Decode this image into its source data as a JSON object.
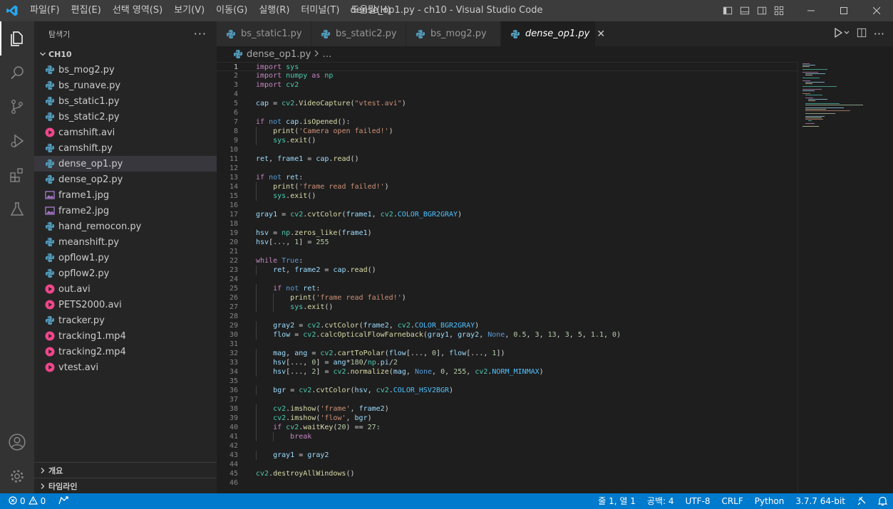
{
  "window": {
    "title": "dense_op1.py - ch10 - Visual Studio Code"
  },
  "menu": [
    "파일(F)",
    "편집(E)",
    "선택 영역(S)",
    "보기(V)",
    "이동(G)",
    "실행(R)",
    "터미널(T)",
    "도움말(H)"
  ],
  "sidebar": {
    "title": "탐색기",
    "folder": "CH10",
    "files": [
      {
        "name": "bs_mog2.py",
        "type": "py"
      },
      {
        "name": "bs_runave.py",
        "type": "py"
      },
      {
        "name": "bs_static1.py",
        "type": "py"
      },
      {
        "name": "bs_static2.py",
        "type": "py"
      },
      {
        "name": "camshift.avi",
        "type": "video"
      },
      {
        "name": "camshift.py",
        "type": "py"
      },
      {
        "name": "dense_op1.py",
        "type": "py",
        "selected": true
      },
      {
        "name": "dense_op2.py",
        "type": "py"
      },
      {
        "name": "frame1.jpg",
        "type": "image"
      },
      {
        "name": "frame2.jpg",
        "type": "image"
      },
      {
        "name": "hand_remocon.py",
        "type": "py"
      },
      {
        "name": "meanshift.py",
        "type": "py"
      },
      {
        "name": "opflow1.py",
        "type": "py"
      },
      {
        "name": "opflow2.py",
        "type": "py"
      },
      {
        "name": "out.avi",
        "type": "video"
      },
      {
        "name": "PETS2000.avi",
        "type": "video"
      },
      {
        "name": "tracker.py",
        "type": "py"
      },
      {
        "name": "tracking1.mp4",
        "type": "video"
      },
      {
        "name": "tracking2.mp4",
        "type": "video"
      },
      {
        "name": "vtest.avi",
        "type": "video"
      }
    ],
    "outline_label": "개요",
    "timeline_label": "타임라인"
  },
  "tabs": [
    {
      "label": "bs_static1.py",
      "active": false
    },
    {
      "label": "bs_static2.py",
      "active": false
    },
    {
      "label": "bs_mog2.py",
      "active": false
    },
    {
      "label": "dense_op1.py",
      "active": true
    }
  ],
  "breadcrumb": {
    "file": "dense_op1.py",
    "rest": "…"
  },
  "code": {
    "current_line": 1,
    "lines": [
      "import sys",
      "import numpy as np",
      "import cv2",
      "",
      "cap = cv2.VideoCapture(\"vtest.avi\")",
      "",
      "if not cap.isOpened():",
      "    print('Camera open failed!')",
      "    sys.exit()",
      "",
      "ret, frame1 = cap.read()",
      "",
      "if not ret:",
      "    print('frame read failed!')",
      "    sys.exit()",
      "",
      "gray1 = cv2.cvtColor(frame1, cv2.COLOR_BGR2GRAY)",
      "",
      "hsv = np.zeros_like(frame1)",
      "hsv[..., 1] = 255",
      "",
      "while True:",
      "    ret, frame2 = cap.read()",
      "",
      "    if not ret:",
      "        print('frame read failed!')",
      "        sys.exit()",
      "",
      "    gray2 = cv2.cvtColor(frame2, cv2.COLOR_BGR2GRAY)",
      "    flow = cv2.calcOpticalFlowFarneback(gray1, gray2, None, 0.5, 3, 13, 3, 5, 1.1, 0)",
      "",
      "    mag, ang = cv2.cartToPolar(flow[..., 0], flow[..., 1])",
      "    hsv[..., 0] = ang*180/np.pi/2",
      "    hsv[..., 2] = cv2.normalize(mag, None, 0, 255, cv2.NORM_MINMAX)",
      "",
      "    bgr = cv2.cvtColor(hsv, cv2.COLOR_HSV2BGR)",
      "",
      "    cv2.imshow('frame', frame2)",
      "    cv2.imshow('flow', bgr)",
      "    if cv2.waitKey(20) == 27:",
      "        break",
      "",
      "    gray1 = gray2",
      "",
      "cv2.destroyAllWindows()",
      ""
    ]
  },
  "statusbar": {
    "errors": "0",
    "warnings": "0",
    "position": "줄 1, 열 1",
    "spaces": "공백: 4",
    "encoding": "UTF-8",
    "eol": "CRLF",
    "language": "Python",
    "interpreter": "3.7.7 64-bit"
  },
  "colors": {
    "accent": "#007acc",
    "python_icon": "#519aba",
    "video_icon": "#f0468a",
    "image_icon": "#a074c4"
  }
}
